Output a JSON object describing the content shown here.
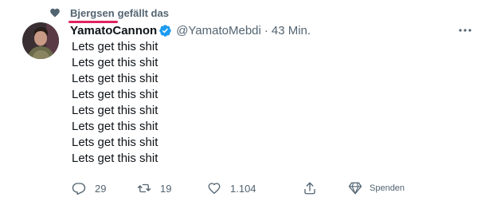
{
  "social_context": {
    "liker": "Bjergsen",
    "text": "gefällt das"
  },
  "tweet": {
    "display_name": "YamatoCannon",
    "handle": "@YamatoMebdi",
    "separator": "·",
    "time": "43 Min.",
    "lines": [
      "Lets get this shit",
      "Lets get this shit",
      "Lets get this shit",
      "Lets get this shit",
      "Lets get this shit",
      "Lets get this shit",
      "Lets get this shit",
      "Lets get this shit"
    ]
  },
  "actions": {
    "replies": "29",
    "retweets": "19",
    "likes": "1.104",
    "tip_label": "Spenden"
  },
  "colors": {
    "accent": "#1d9bf0",
    "highlight_underline": "#e0245e",
    "secondary_text": "#536471",
    "primary_text": "#0f1419"
  },
  "icons": [
    "heart-icon",
    "verified-badge-icon",
    "more-icon",
    "reply-icon",
    "retweet-icon",
    "like-icon",
    "share-icon",
    "tip-icon"
  ]
}
